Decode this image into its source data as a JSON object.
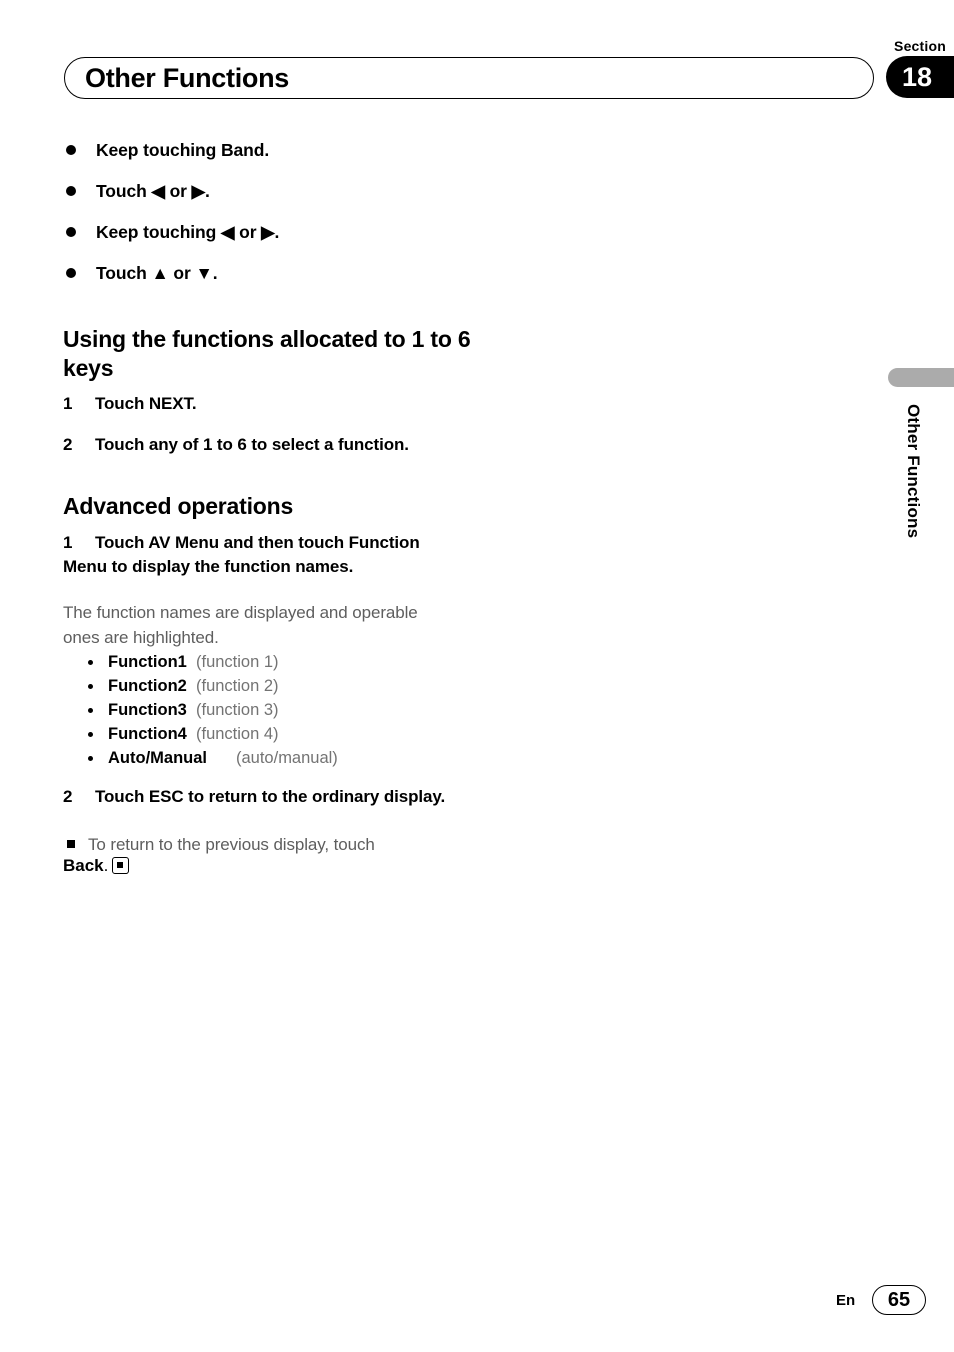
{
  "header": {
    "section_label": "Section",
    "section_number": "18",
    "title": "Other Functions"
  },
  "side_tab": {
    "label": "Other Functions"
  },
  "operations": [
    {
      "text": "Keep touching Band."
    },
    {
      "text": "Touch ◀ or ▶."
    },
    {
      "text": "Keep touching ◀ or ▶."
    },
    {
      "text": "Touch ▲ or ▼."
    }
  ],
  "section_keys": {
    "heading": "Using the functions allocated to 1 to 6 keys",
    "steps": [
      {
        "num": "1",
        "text": "Touch NEXT."
      },
      {
        "num": "2",
        "text": "Touch any of 1 to 6 to select a function."
      }
    ]
  },
  "section_advanced": {
    "heading": "Advanced operations",
    "step1_num": "1",
    "step1_text": "Touch AV Menu and then touch Function Menu to display the function names.",
    "step1_note": "The function names are displayed and operable ones are highlighted.",
    "functions": [
      {
        "label": "Function1",
        "paren": "(function 1)"
      },
      {
        "label": "Function2",
        "paren": "(function 2)"
      },
      {
        "label": "Function3",
        "paren": "(function 3)"
      },
      {
        "label": "Function4",
        "paren": "(function 4)"
      },
      {
        "label": "Auto/Manual",
        "paren": "(auto/manual)"
      }
    ],
    "step2_num": "2",
    "step2_text": "Touch ESC to return to the ordinary display.",
    "step2_note": "To return to the previous display, touch",
    "step2_note_bold": "Back",
    "step2_note_period": "."
  },
  "footer": {
    "language": "En",
    "page": "65"
  },
  "colors": {
    "accent_gray": "#ababab",
    "body_gray": "#5e5e5e",
    "paren_gray": "#737373"
  }
}
